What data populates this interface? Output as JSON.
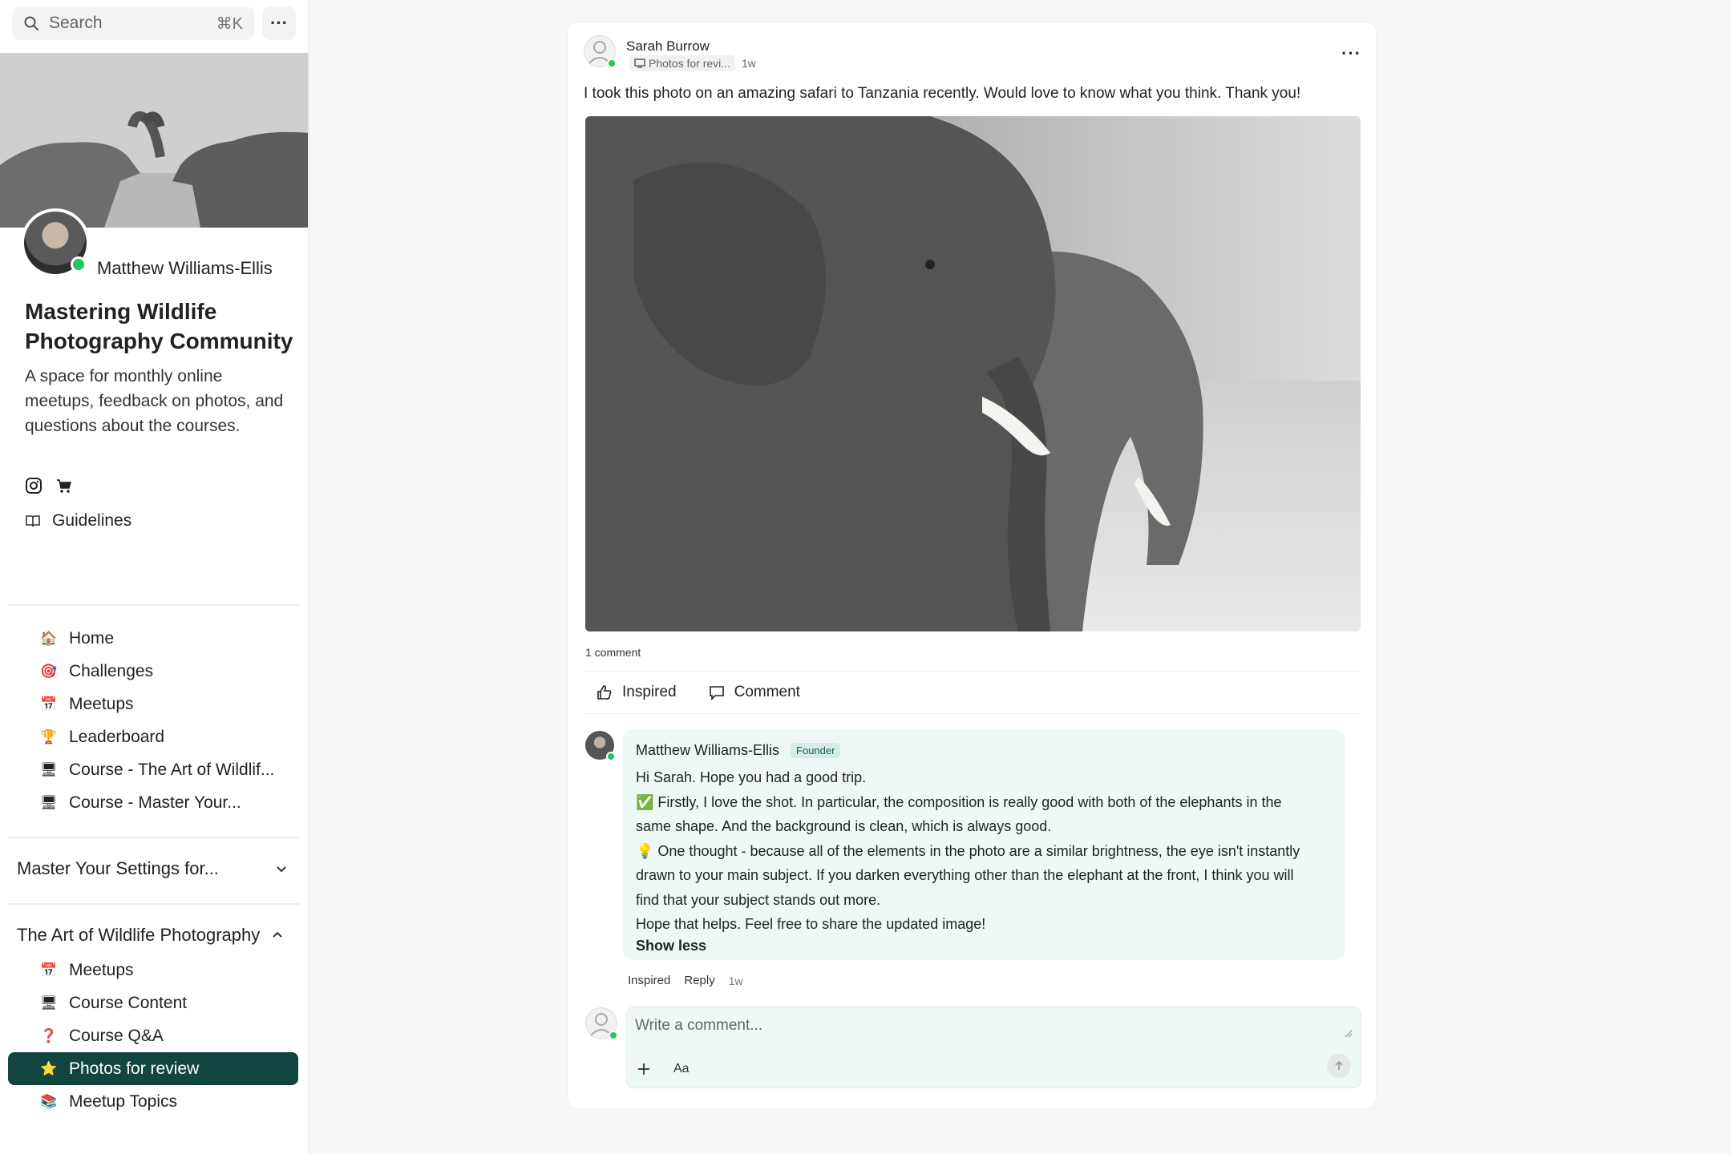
{
  "search": {
    "placeholder": "Search",
    "shortcut": "⌘K"
  },
  "sidebar": {
    "owner_name": "Matthew Williams-Ellis",
    "community_title": "Mastering Wildlife Photography Community",
    "community_description": "A space for monthly online meetups, feedback on photos, and questions about the courses.",
    "social_icons": [
      "instagram-icon",
      "cart-icon"
    ],
    "guidelines_label": "Guidelines",
    "nav_items": [
      {
        "emoji": "🏠",
        "label": "Home"
      },
      {
        "emoji": "🎯",
        "label": "Challenges"
      },
      {
        "emoji": "📅",
        "label": "Meetups"
      },
      {
        "emoji": "🏆",
        "label": "Leaderboard"
      },
      {
        "emoji": "🖥",
        "label": "Course - The Art of Wildlif..."
      },
      {
        "emoji": "🖥",
        "label": "Course - Master Your..."
      }
    ],
    "section_collapsed": {
      "label": "Master Your Settings for..."
    },
    "section_expanded": {
      "label": "The Art of Wildlife Photography",
      "items": [
        {
          "emoji": "📅",
          "label": "Meetups"
        },
        {
          "emoji": "🖥",
          "label": "Course Content"
        },
        {
          "emoji": "❓",
          "label": "Course Q&A"
        },
        {
          "emoji": "⭐",
          "label": "Photos for review",
          "active": true
        },
        {
          "emoji": "📚",
          "label": "Meetup Topics"
        }
      ]
    }
  },
  "post": {
    "author": "Sarah Burrow",
    "space": "Photos for revi...",
    "time": "1w",
    "body": "I took this photo on an amazing safari to Tanzania recently. Would love to know what you think. Thank you!",
    "comment_count": "1 comment",
    "actions": {
      "inspired": "Inspired",
      "comment": "Comment"
    }
  },
  "comment": {
    "author": "Matthew Williams-Ellis",
    "badge": "Founder",
    "lines": [
      "Hi Sarah. Hope you had a good trip.",
      "✅ Firstly, I love the shot. In particular, the composition is really good with both of the elephants in the",
      "same shape. And the background is clean, which is always good.",
      "💡 One thought - because all of the elements in the photo are a similar brightness, the eye isn't instantly",
      "drawn to your main subject. If you darken everything other than the elephant at the front, I think you will",
      "find that your subject stands out more.",
      "Hope that helps. Feel free to share the updated image!"
    ],
    "show_less": "Show less",
    "actions": {
      "inspired": "Inspired",
      "reply": "Reply",
      "time": "1w"
    }
  },
  "composer": {
    "placeholder": "Write a comment...",
    "format_label": "Aa"
  },
  "colors": {
    "accent": "#12453f",
    "online": "#22c55e",
    "comment_bg": "#eef8f6",
    "badge_bg": "#d6ece7"
  }
}
